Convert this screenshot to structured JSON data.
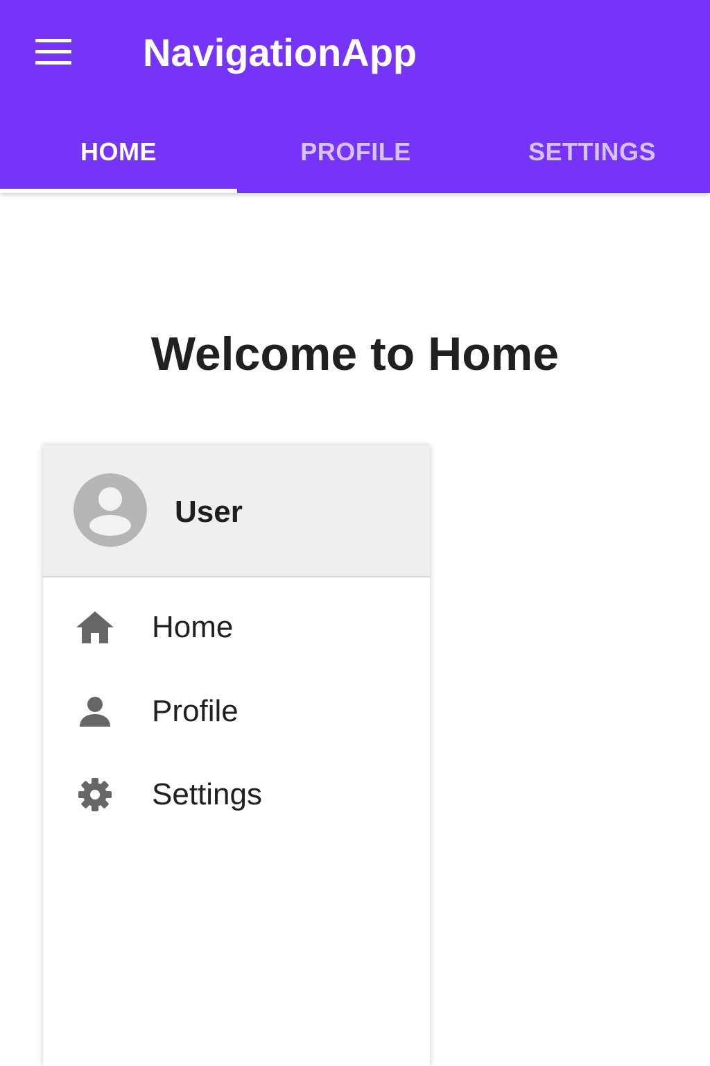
{
  "app": {
    "title": "NavigationApp"
  },
  "colors": {
    "primary": "#7634f9",
    "tab_active": "#ffffff",
    "tab_inactive": "#d7c3fc",
    "icon_gray": "#666666",
    "avatar_gray": "#b5b5b5"
  },
  "tabs": [
    {
      "label": "HOME",
      "active": true
    },
    {
      "label": "PROFILE",
      "active": false
    },
    {
      "label": "SETTINGS",
      "active": false
    }
  ],
  "main": {
    "title": "Welcome to Home"
  },
  "drawer": {
    "user_name": "User",
    "items": [
      {
        "label": "Home",
        "icon": "home-icon"
      },
      {
        "label": "Profile",
        "icon": "person-icon"
      },
      {
        "label": "Settings",
        "icon": "gear-icon"
      }
    ]
  }
}
